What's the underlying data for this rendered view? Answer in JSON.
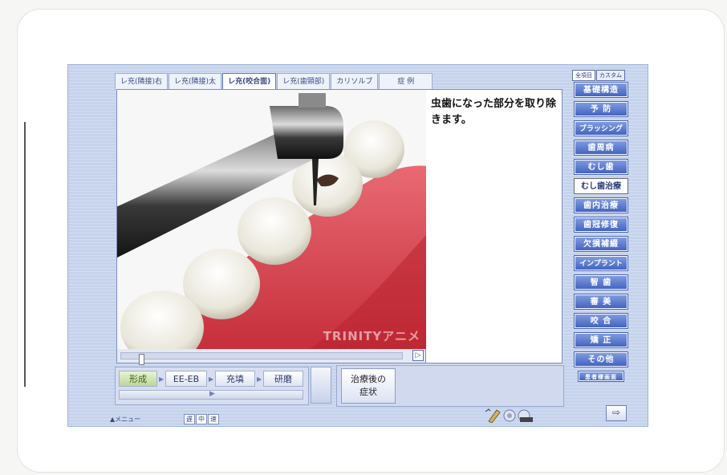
{
  "tabs": [
    {
      "label": "レ充(隣接)右",
      "active": false
    },
    {
      "label": "レ充(隣接)太",
      "active": false
    },
    {
      "label": "レ充(咬合面)",
      "active": true
    },
    {
      "label": "レ充(歯頸部)",
      "active": false
    },
    {
      "label": "カリソルブ",
      "active": false
    },
    {
      "label": "症 例",
      "active": false
    }
  ],
  "description": "虫歯になった部分を取り除きます。",
  "watermark": "TRINITYアニメ",
  "player": {
    "play_symbol": "▷"
  },
  "steps": [
    {
      "label": "形成",
      "current": true
    },
    {
      "label": "EE-EB",
      "current": false
    },
    {
      "label": "充填",
      "current": false
    },
    {
      "label": "研磨",
      "current": false
    }
  ],
  "after_button": {
    "line1": "治療後の",
    "line2": "症状"
  },
  "sidebar": {
    "tabs": [
      "全項目",
      "カスタム"
    ],
    "items": [
      {
        "label": "基礎構造",
        "active": false
      },
      {
        "label": "予 防",
        "active": false
      },
      {
        "label": "ブラッシング",
        "active": false
      },
      {
        "label": "歯周病",
        "active": false
      },
      {
        "label": "むし歯",
        "active": false
      },
      {
        "label": "むし歯治療",
        "active": true
      },
      {
        "label": "歯内治療",
        "active": false
      },
      {
        "label": "歯冠修復",
        "active": false
      },
      {
        "label": "欠損補綴",
        "active": false
      },
      {
        "label": "インプラント",
        "active": false
      },
      {
        "label": "智 歯",
        "active": false
      },
      {
        "label": "審 美",
        "active": false
      },
      {
        "label": "咬 合",
        "active": false
      },
      {
        "label": "矯 正",
        "active": false
      },
      {
        "label": "その他",
        "active": false
      }
    ],
    "small_button": "患者様画面"
  },
  "footer": {
    "menu_link": "▲メニュー",
    "speed": [
      "遅",
      "中",
      "速"
    ],
    "exit_symbol": "⇨"
  },
  "colors": {
    "gum": "#d9414c",
    "frame_bg": "#c6d3ec",
    "accent": "#4464c0"
  }
}
